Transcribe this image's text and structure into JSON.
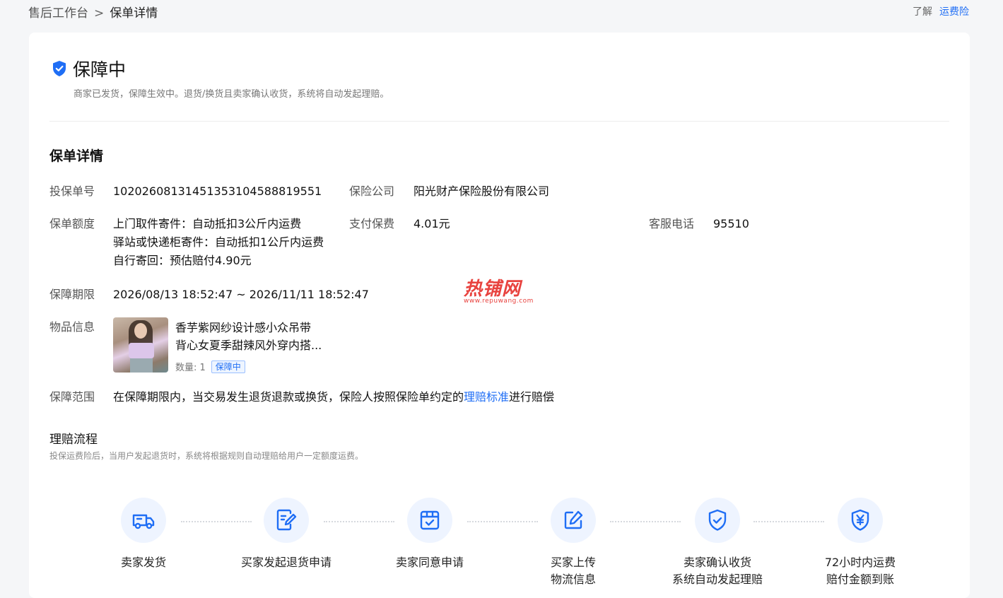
{
  "breadcrumb": {
    "root": "售后工作台",
    "separator": ">",
    "current": "保单详情"
  },
  "top_links": {
    "learn": "了解",
    "freight_insurance": "运费险"
  },
  "status": {
    "title": "保障中",
    "desc": "商家已发货，保障生效中。退货/换货且卖家确认收货，系统将自动发起理赔。"
  },
  "policy": {
    "section_title": "保单详情",
    "policy_no_label": "投保单号",
    "policy_no": "10202608131451353104588819551",
    "insurer_label": "保险公司",
    "insurer": "阳光财产保险股份有限公司",
    "amount_label": "保单额度",
    "amount_lines": [
      "上门取件寄件：自动抵扣3公斤内运费",
      "驿站或快递柜寄件：自动抵扣1公斤内运费",
      "自行寄回：预估赔付4.90元"
    ],
    "premium_label": "支付保费",
    "premium": "4.01元",
    "hotline_label": "客服电话",
    "hotline": "95510",
    "period_label": "保障期限",
    "period": "2026/08/13 18:52:47 ~ 2026/11/11 18:52:47",
    "goods_label": "物品信息",
    "goods_title_line1": "香芋紫网纱设计感小众吊带",
    "goods_title_line2": "背心女夏季甜辣风外穿内搭...",
    "goods_qty": "数量: 1",
    "goods_tag": "保障中",
    "range_label": "保障范围",
    "range_text_before": "在保障期限内，当交易发生退货退款或换货，保险人按照保险单约定的",
    "range_link": "理赔标准",
    "range_text_after": "进行赔偿"
  },
  "flow": {
    "title": "理赔流程",
    "desc": "投保运费险后，当用户发起退货时，系统将根据规则自动理赔给用户一定额度运费。",
    "steps": [
      {
        "icon": "truck-icon",
        "line1": "卖家发货",
        "line2": ""
      },
      {
        "icon": "form-edit-icon",
        "line1": "买家发起退货申请",
        "line2": ""
      },
      {
        "icon": "box-check-icon",
        "line1": "卖家同意申请",
        "line2": ""
      },
      {
        "icon": "edit-icon",
        "line1": "买家上传",
        "line2": "物流信息"
      },
      {
        "icon": "shield-check-icon",
        "line1": "卖家确认收货",
        "line2": "系统自动发起理赔"
      },
      {
        "icon": "shield-yen-icon",
        "line1": "72小时内运费",
        "line2": "赔付金额到账"
      }
    ]
  },
  "watermark": {
    "brand": "热铺网",
    "url": "www.repuwang.com"
  },
  "colors": {
    "accent": "#1f6ef5",
    "icon_bg": "#eef4ff",
    "watermark": "#e8433f"
  }
}
